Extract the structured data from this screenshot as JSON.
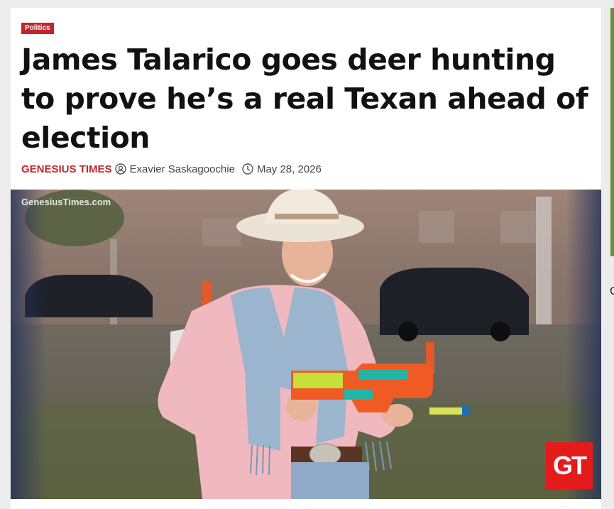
{
  "article": {
    "category": "Politics",
    "title": "James Talarico goes deer hunting to prove he’s a real Texan ahead of election",
    "source": "GENESIUS TIMES",
    "author": "Exavier Saskagoochie",
    "date": "May 28, 2026"
  },
  "image": {
    "watermark": "GenesiusTimes.com",
    "logo_text": "GT"
  },
  "side": {
    "char": "C"
  },
  "colors": {
    "accent": "#c0262c",
    "logo": "#e31b1b"
  }
}
